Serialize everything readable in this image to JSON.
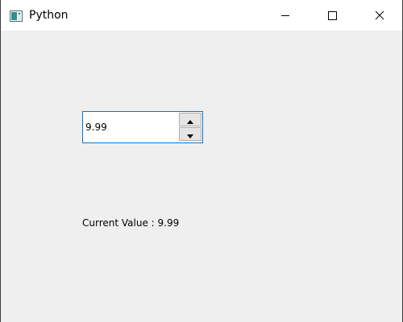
{
  "window": {
    "title": "Python"
  },
  "titlebar_buttons": {
    "minimize_icon": "minimize-icon",
    "maximize_icon": "maximize-icon",
    "close_icon": "close-icon"
  },
  "spinbox": {
    "value": "9.99",
    "up_icon": "triangle-up-icon",
    "down_icon": "triangle-down-icon"
  },
  "status": {
    "label": "Current Value : 9.99"
  },
  "colors": {
    "focus_border": "#0078d7",
    "window_background": "#efefef"
  }
}
